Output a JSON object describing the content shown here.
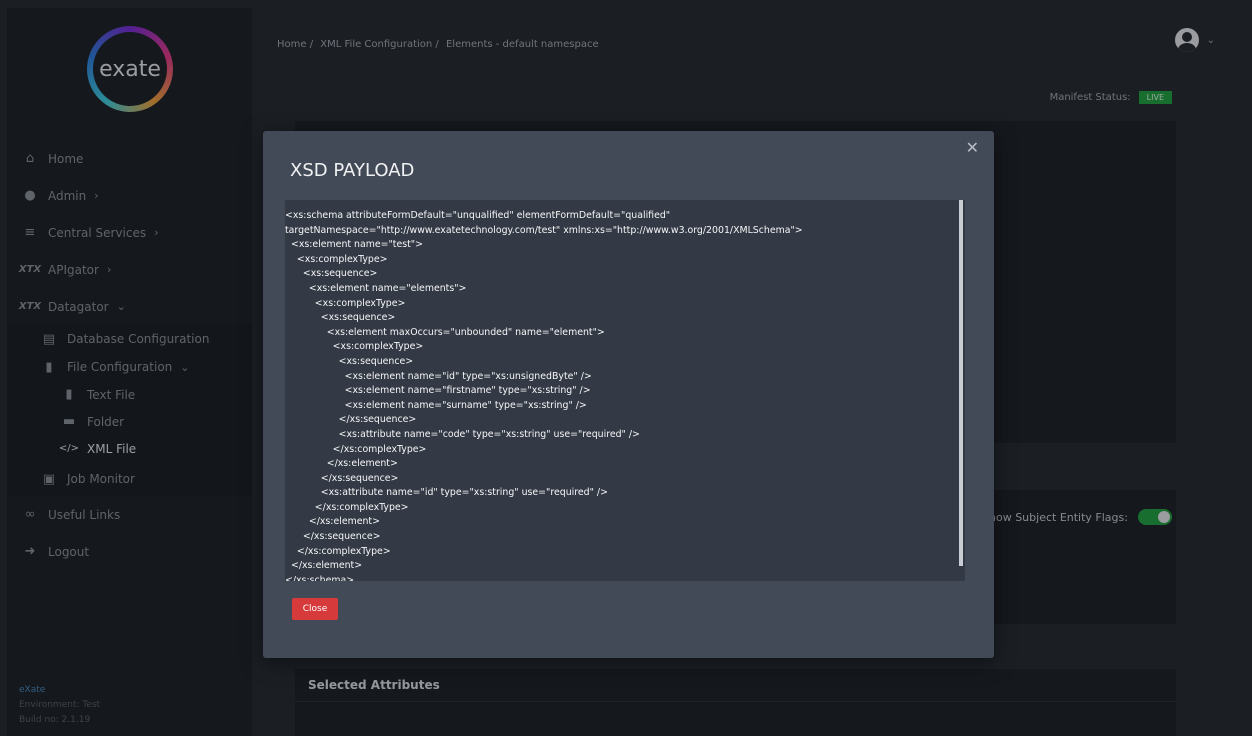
{
  "app": {
    "logo_text": "exate",
    "footer": {
      "brand": "eXate",
      "environment": "Environment: Test",
      "build": "Build no: 2.1.19"
    }
  },
  "sidebar": {
    "items": [
      {
        "label": "Home",
        "icon": "home-icon"
      },
      {
        "label": "Admin",
        "icon": "users-icon"
      },
      {
        "label": "Central Services",
        "icon": "layers-icon"
      },
      {
        "label": "APIgator",
        "icon": "apigator-icon"
      },
      {
        "label": "Datagator",
        "icon": "datagator-icon"
      },
      {
        "label": "Database Configuration",
        "icon": "database-icon"
      },
      {
        "label": "File Configuration",
        "icon": "file-icon"
      },
      {
        "label": "Text File",
        "icon": "text-file-icon"
      },
      {
        "label": "Folder",
        "icon": "folder-icon"
      },
      {
        "label": "XML File",
        "icon": "code-icon"
      },
      {
        "label": "Job Monitor",
        "icon": "briefcase-icon"
      },
      {
        "label": "Useful Links",
        "icon": "link-icon"
      },
      {
        "label": "Logout",
        "icon": "logout-icon"
      }
    ]
  },
  "header": {
    "breadcrumb": [
      "Home /",
      "XML File Configuration /",
      "Elements - default namespace"
    ],
    "manifest_label": "Manifest Status:",
    "manifest_value": "LIVE"
  },
  "content": {
    "flags_label": "how Subject Entity Flags:",
    "selected_attributes_title": "Selected Attributes"
  },
  "modal": {
    "title": "XSD PAYLOAD",
    "close_button": "Close",
    "lines": [
      "<xs:schema attributeFormDefault=\"unqualified\" elementFormDefault=\"qualified\"",
      "targetNamespace=\"http://www.exatetechnology.com/test\" xmlns:xs=\"http://www.w3.org/2001/XMLSchema\">",
      "  <xs:element name=\"test\">",
      "    <xs:complexType>",
      "      <xs:sequence>",
      "        <xs:element name=\"elements\">",
      "          <xs:complexType>",
      "            <xs:sequence>",
      "              <xs:element maxOccurs=\"unbounded\" name=\"element\">",
      "                <xs:complexType>",
      "                  <xs:sequence>",
      "                    <xs:element name=\"id\" type=\"xs:unsignedByte\" />",
      "                    <xs:element name=\"firstname\" type=\"xs:string\" />",
      "                    <xs:element name=\"surname\" type=\"xs:string\" />",
      "                  </xs:sequence>",
      "                  <xs:attribute name=\"code\" type=\"xs:string\" use=\"required\" />",
      "                </xs:complexType>",
      "              </xs:element>",
      "            </xs:sequence>",
      "            <xs:attribute name=\"id\" type=\"xs:string\" use=\"required\" />",
      "          </xs:complexType>",
      "        </xs:element>",
      "      </xs:sequence>",
      "    </xs:complexType>",
      "  </xs:element>",
      "</xs:schema>"
    ]
  },
  "colors": {
    "live": "#21a440",
    "close_button": "#d63a3a",
    "modal_bg": "#434a57"
  }
}
